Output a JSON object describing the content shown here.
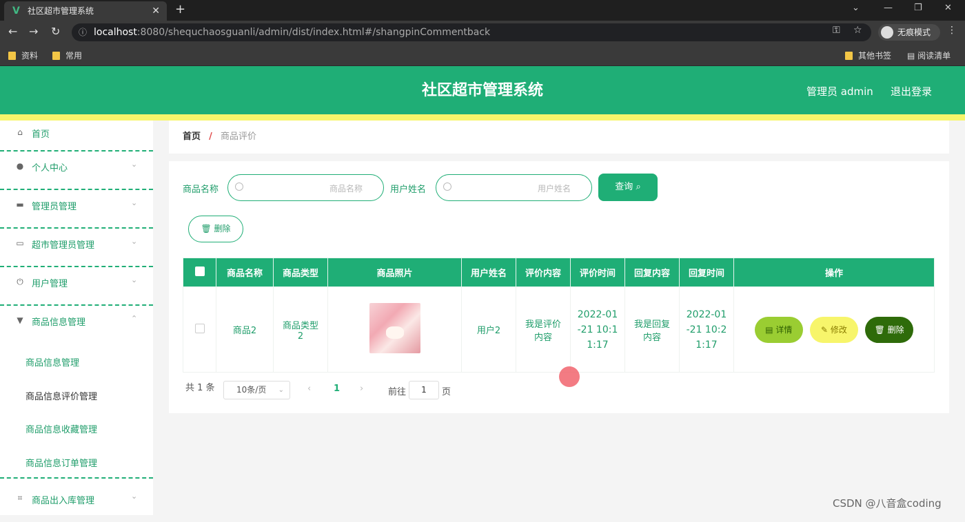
{
  "browser": {
    "tab_title": "社区超市管理系统",
    "url_host": "localhost",
    "url_path": ":8080/shequchaosguanli/admin/dist/index.html#/shangpinCommentback",
    "incognito_label": "无痕模式",
    "bookmarks": [
      "资料",
      "常用"
    ],
    "bookmarks_right": [
      "其他书签",
      "阅读清单"
    ]
  },
  "header": {
    "title": "社区超市管理系统",
    "admin_label": "管理员 admin",
    "logout_label": "退出登录"
  },
  "sidebar": {
    "items": [
      {
        "label": "首页",
        "icon": "home-icon"
      },
      {
        "label": "个人中心",
        "icon": "user-icon"
      },
      {
        "label": "管理员管理",
        "icon": "monitor-icon"
      },
      {
        "label": "超市管理员管理",
        "icon": "card-icon"
      },
      {
        "label": "用户管理",
        "icon": "power-icon"
      },
      {
        "label": "商品信息管理",
        "icon": "cup-icon"
      },
      {
        "label": "商品出入库管理",
        "icon": "crop-icon"
      }
    ],
    "subitems": [
      "商品信息管理",
      "商品信息评价管理",
      "商品信息收藏管理",
      "商品信息订单管理"
    ]
  },
  "breadcrumb": {
    "home": "首页",
    "sep": "/",
    "current": "商品评价"
  },
  "search": {
    "product_label": "商品名称",
    "product_placeholder": "商品名称",
    "user_label": "用户姓名",
    "user_placeholder": "用户姓名",
    "query_button": "查询",
    "delete_button": "删除"
  },
  "table": {
    "headers": [
      "商品名称",
      "商品类型",
      "商品照片",
      "用户姓名",
      "评价内容",
      "评价时间",
      "回复内容",
      "回复时间",
      "操作"
    ],
    "rows": [
      {
        "name": "商品2",
        "type": "商品类型2",
        "user": "用户2",
        "comment": "我是评价内容",
        "comment_time": "2022-01-21 10:11:17",
        "reply": "我是回复内容",
        "reply_time": "2022-01-21 10:21:17"
      }
    ],
    "actions": {
      "detail": "详情",
      "edit": "修改",
      "delete": "删除"
    }
  },
  "pagination": {
    "total": "共 1 条",
    "page_size": "10条/页",
    "current_page": "1",
    "goto_label": "前往",
    "goto_value": "1",
    "page_suffix": "页"
  },
  "watermark": "CSDN @八音盒coding",
  "colors": {
    "primary": "#1fae76",
    "accent_yellow": "#f7f56b",
    "detail_btn": "#9acd32",
    "delete_btn": "#2e6b0a"
  }
}
